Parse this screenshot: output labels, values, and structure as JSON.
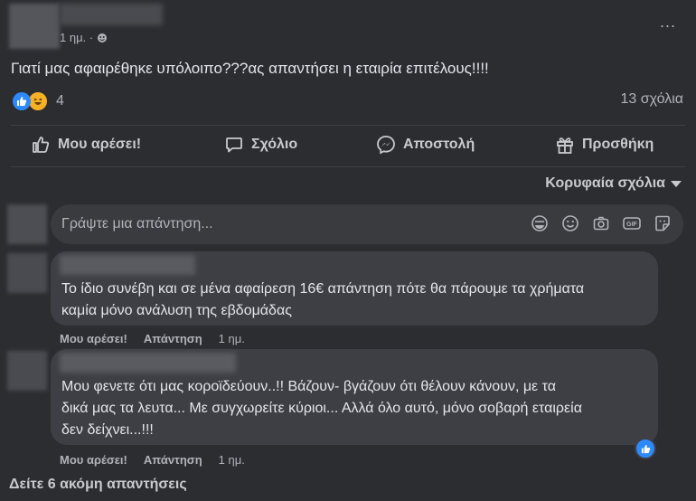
{
  "post": {
    "time": "1 ημ. ·",
    "text": "Γιατί μας αφαιρέθηκε υπόλοιπο???ας απαντήσει η εταιρία επιτέλους!!!!",
    "reaction_count": "4",
    "comments_count": "13 σχόλια",
    "more": "..."
  },
  "actions": {
    "like": "Μου αρέσει!",
    "comment": "Σχόλιο",
    "send": "Αποστολή",
    "add": "Προσθήκη"
  },
  "sort_label": "Κορυφαία σχόλια",
  "reply_placeholder": "Γράψτε μια απάντηση...",
  "comments": [
    {
      "text_line1": "Το ίδιο συνέβη και σε μένα αφαίρεση 16€ απάντηση πότε θα πάρουμε τα χρήματα",
      "text_line2": "καμία μόνο ανάλυση της εβδομάδας",
      "like": "Μου αρέσει!",
      "reply": "Απάντηση",
      "time": "1 ημ."
    },
    {
      "text_line1": "Μου φενετε ότι μας κοροϊδεύουν..!! Βάζουν- βγάζουν ότι θέλουν κάνουν, με τα",
      "text_line2": "δικά μας τα λευτα... Με συγχωρείτε κύριοι... Αλλά όλο αυτό, μόνο σοβαρή εταιρεία",
      "text_line3": "δεν δείχνει...!!!",
      "like": "Μου αρέσει!",
      "reply": "Απάντηση",
      "time": "1 ημ."
    }
  ],
  "more_replies": "Δείτε 6 ακόμη απαντήσεις",
  "colors": {
    "accent": "#2e89ff",
    "background": "#2c2d31",
    "bubble": "#3e3f44"
  }
}
